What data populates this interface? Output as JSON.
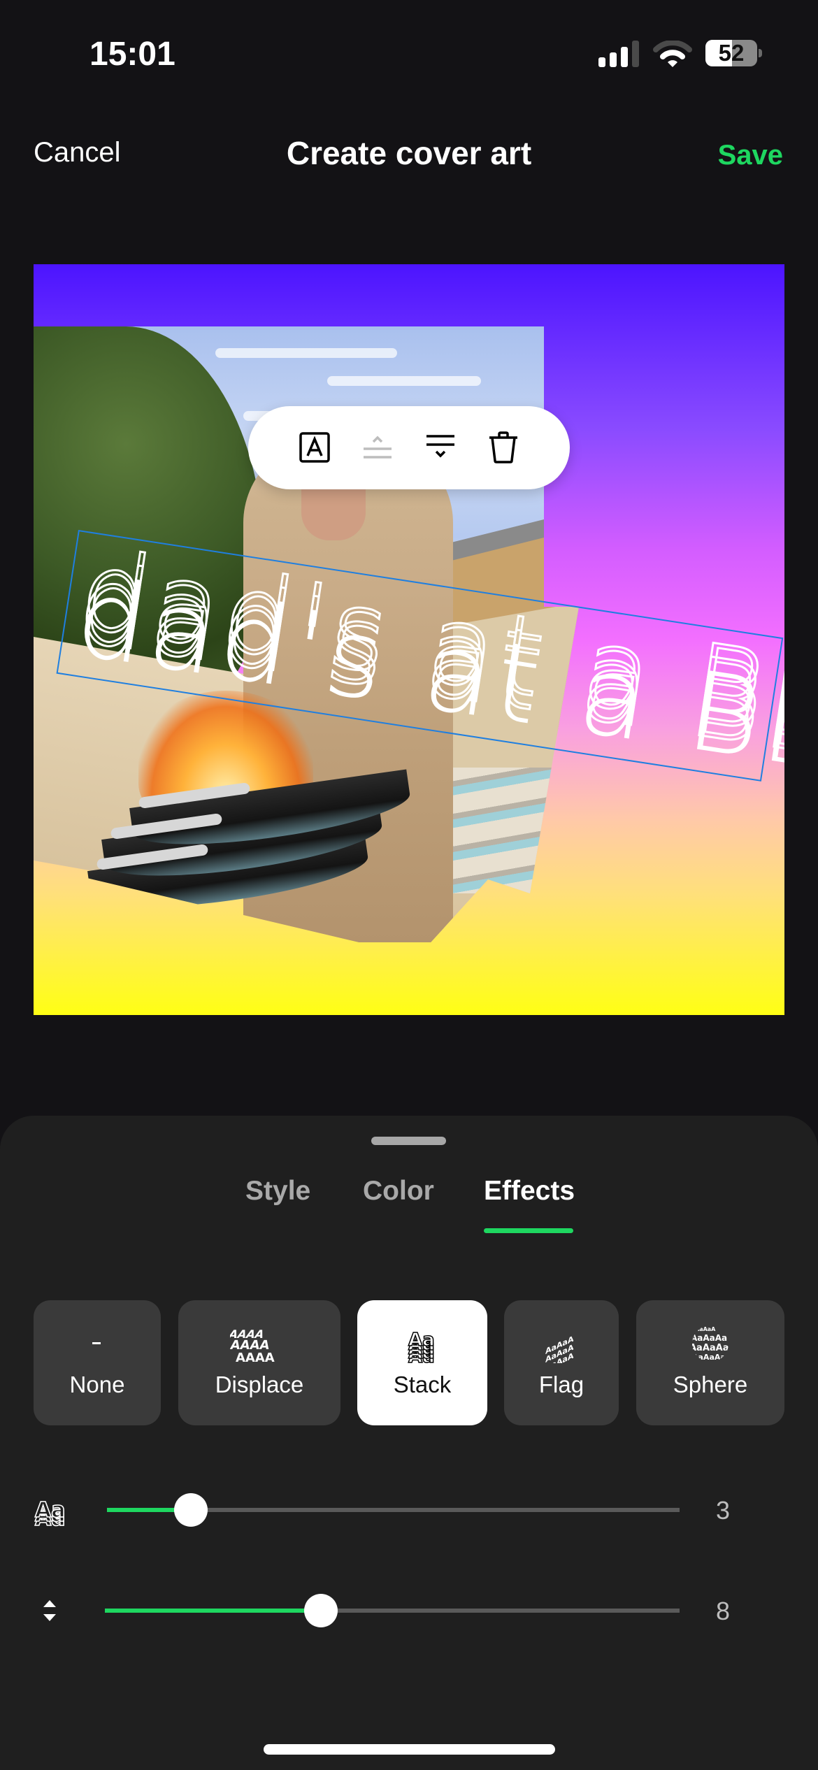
{
  "status_bar": {
    "time": "15:01",
    "battery_percent": "52",
    "battery_level": 0.52,
    "signal_bars_active": 3,
    "signal_bars_total": 4,
    "icons": [
      "cellular-signal-icon",
      "wifi-icon",
      "battery-icon"
    ]
  },
  "nav": {
    "cancel_label": "Cancel",
    "title": "Create cover art",
    "save_label": "Save"
  },
  "canvas": {
    "background_gradient": [
      "#4c14ff",
      "#f36fff",
      "#ffff14"
    ],
    "overlay_text": "dad's at a BBQ",
    "stack_copies": 3,
    "selection_color": "#1f7fe0",
    "text_toolbar": {
      "tools": [
        {
          "name": "text-style-icon",
          "enabled": true
        },
        {
          "name": "bring-forward-icon",
          "enabled": false
        },
        {
          "name": "send-backward-icon",
          "enabled": true
        },
        {
          "name": "delete-icon",
          "enabled": true
        }
      ]
    }
  },
  "sheet": {
    "tabs": [
      {
        "label": "Style",
        "active": false
      },
      {
        "label": "Color",
        "active": false
      },
      {
        "label": "Effects",
        "active": true
      }
    ],
    "effects": [
      {
        "label": "None",
        "icon": "dash-icon",
        "selected": false
      },
      {
        "label": "Displace",
        "icon": "displace-icon",
        "selected": false
      },
      {
        "label": "Stack",
        "icon": "stack-icon",
        "selected": true
      },
      {
        "label": "Flag",
        "icon": "flag-icon",
        "selected": false
      },
      {
        "label": "Sphere",
        "icon": "sphere-icon",
        "selected": false
      }
    ],
    "sliders": [
      {
        "icon": "stack-count-icon",
        "value": "3",
        "fraction": 0.147
      },
      {
        "icon": "spacing-icon",
        "value": "8",
        "fraction": 0.376
      }
    ]
  },
  "colors": {
    "accent": "#1ed760",
    "background": "#131215",
    "sheet": "#1f1f1f"
  }
}
